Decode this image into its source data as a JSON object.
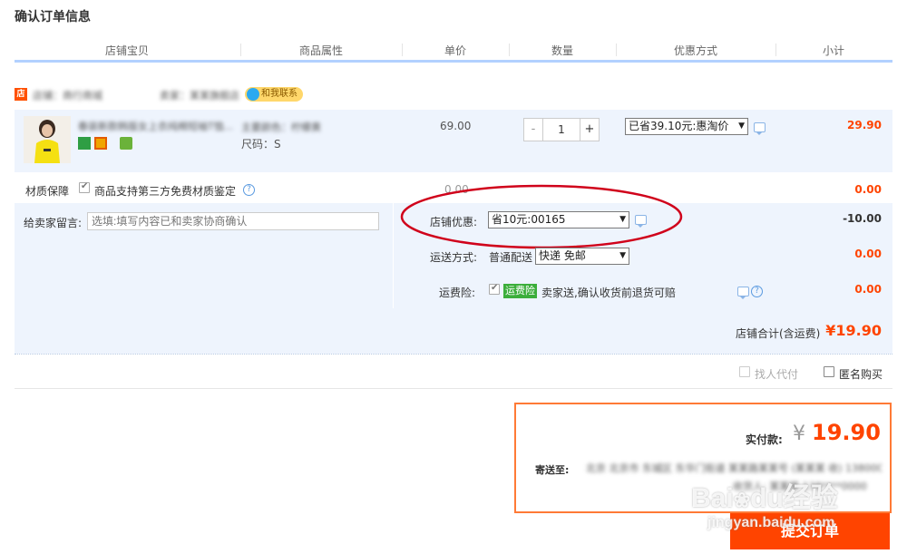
{
  "page_title": "确认订单信息",
  "columns": [
    "店铺宝贝",
    "商品属性",
    "单价",
    "数量",
    "优惠方式",
    "小计"
  ],
  "shop": {
    "name_blurred": "店铺：商行商城",
    "seller_blurred": "卖家：某某旗舰店",
    "contact_label": "和我联系"
  },
  "product": {
    "title_blurred": "春装新款韩版女上衣纯棉短袖T恤...",
    "color_label": "主要颜色：柠檬黄",
    "size_label": "尺码：S",
    "unit_price": "69.00",
    "quantity": "1",
    "qty_minus": "-",
    "qty_plus": "+",
    "discount_option": "已省39.10元:惠淘价",
    "subtotal": "29.90"
  },
  "quality": {
    "label": "材质保障",
    "checkbox_text": "商品支持第三方免费材质鉴定",
    "price": "0.00",
    "subtotal": "0.00"
  },
  "message": {
    "label": "给卖家留言:",
    "placeholder": "选填:填写内容已和卖家协商确认"
  },
  "shop_discount": {
    "label": "店铺优惠:",
    "value": "省10元:00165",
    "amount": "-10.00"
  },
  "shipping": {
    "label": "运送方式:",
    "method": "普通配送",
    "option": "快递 免邮",
    "amount": "0.00"
  },
  "insurance": {
    "label": "运费险:",
    "tag": "运费险",
    "text": "卖家送,确认收货前退货可赔",
    "amount": "0.00"
  },
  "shop_total": {
    "label": "店铺合计(含运费)",
    "amount": "¥19.90"
  },
  "options": {
    "proxy_pay": "找人代付",
    "anonymous": "匿名购买"
  },
  "summary": {
    "pay_label": "实付款:",
    "currency": "¥",
    "amount": "19.90",
    "ship_to_label": "寄送至:",
    "address_blurred": "北京 北京市 东城区 东华门街道 某某路某某号 (某某某 收) 1380000000",
    "receiver_blurred": "收货人: 某某某 138****0000"
  },
  "submit_label": "提交订单",
  "watermark": {
    "logo_a": "Bai",
    "logo_b": "du",
    "logo_c": "经验",
    "url": "jingyan.baidu.com"
  },
  "colors": {
    "accent": "#ff4400",
    "highlight_circle": "#d0021b",
    "panel": "#eef4fd",
    "header_rule": "#b2d1ff"
  }
}
